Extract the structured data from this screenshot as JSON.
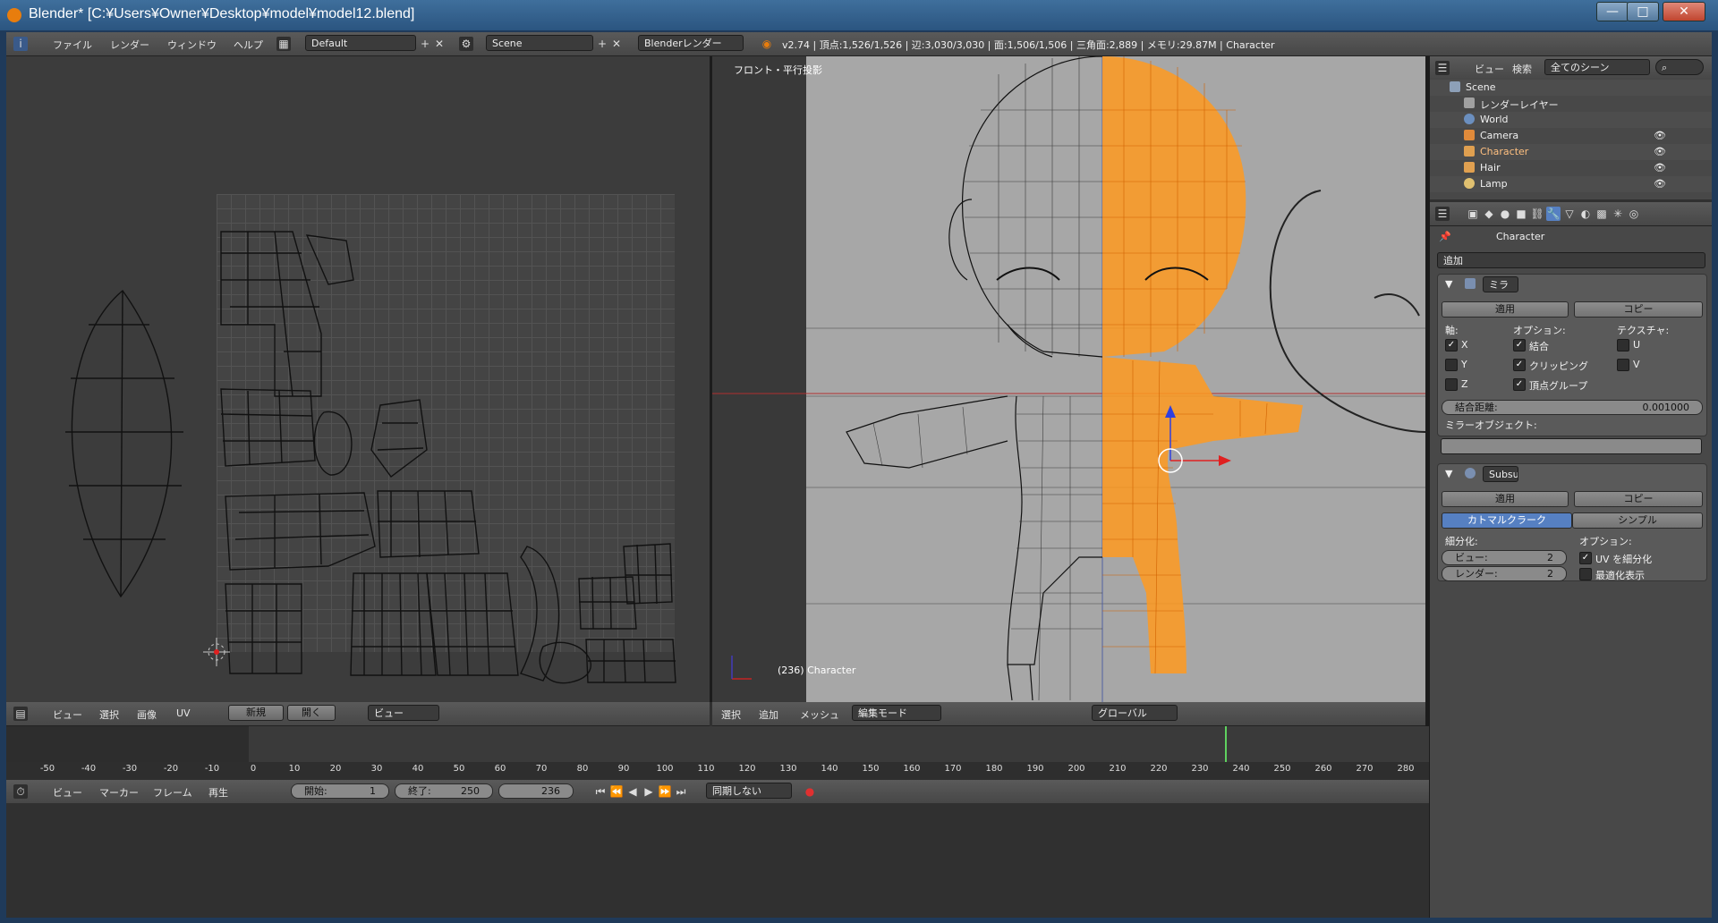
{
  "window": {
    "title": "Blender* [C:¥Users¥Owner¥Desktop¥model¥model12.blend]",
    "minimize": "—",
    "maximize": "□",
    "close": "✕"
  },
  "info_header": {
    "menus": [
      "ファイル",
      "レンダー",
      "ウィンドウ",
      "ヘルプ"
    ],
    "screen_layout": "Default",
    "scene": "Scene",
    "render_engine": "Blenderレンダー",
    "stats": "v2.74 | 頂点:1,526/1,526 | 辺:3,030/3,030 | 面:1,506/1,506 | 三角面:2,889 | メモリ:29.87M | Character"
  },
  "uv_editor": {
    "menus": [
      "ビュー",
      "選択",
      "画像",
      "UV"
    ],
    "new_label": "新規",
    "open_label": "開く",
    "view_label": "ビュー"
  },
  "view3d": {
    "projection_label": "フロント・平行投影",
    "object_label": "(236) Character",
    "menus": [
      "選択",
      "追加",
      "メッシュ"
    ],
    "mode": "編集モード",
    "orientation": "グローバル"
  },
  "outliner": {
    "menus": [
      "ビュー",
      "検索"
    ],
    "scene_filter": "全てのシーン",
    "items": [
      {
        "label": "Scene",
        "icon_color": "#8da0b8"
      },
      {
        "label": "レンダーレイヤー",
        "icon_color": "#a0a0a0"
      },
      {
        "label": "World",
        "icon_color": "#6b8fbf"
      },
      {
        "label": "Camera",
        "icon_color": "#e08a3a"
      },
      {
        "label": "Character",
        "icon_color": "#e0a050"
      },
      {
        "label": "Hair",
        "icon_color": "#e0a050"
      },
      {
        "label": "Lamp",
        "icon_color": "#e0c070"
      }
    ]
  },
  "properties": {
    "breadcrumb": "Character",
    "add_modifier": "追加",
    "mirror": {
      "name": "ミラ",
      "apply": "適用",
      "copy": "コピー",
      "axis_heading": "軸:",
      "options_heading": "オプション:",
      "texture_heading": "テクスチャ:",
      "axes": [
        {
          "label": "X",
          "checked": true
        },
        {
          "label": "Y",
          "checked": false
        },
        {
          "label": "Z",
          "checked": false
        }
      ],
      "options": [
        {
          "label": "結合",
          "checked": true
        },
        {
          "label": "クリッピング",
          "checked": true
        },
        {
          "label": "頂点グループ",
          "checked": true
        }
      ],
      "textures": [
        {
          "label": "U",
          "checked": false
        },
        {
          "label": "V",
          "checked": false
        }
      ],
      "merge_distance_label": "結合距離:",
      "merge_distance_value": "0.001000",
      "mirror_object_label": "ミラーオブジェクト:"
    },
    "subsurf": {
      "name": "Subsu",
      "apply": "適用",
      "copy": "コピー",
      "tab_catmull": "カトマルクラーク",
      "tab_simple": "シンプル",
      "subdiv_heading": "細分化:",
      "options_heading": "オプション:",
      "view_label": "ビュー:",
      "view_value": "2",
      "render_label": "レンダー:",
      "render_value": "2",
      "uv_subdiv": "UV を細分化",
      "uv_subdiv_checked": true,
      "optimal": "最適化表示",
      "optimal_checked": false
    }
  },
  "timeline": {
    "ticks": [
      "-50",
      "-40",
      "-30",
      "-20",
      "-10",
      "0",
      "10",
      "20",
      "30",
      "40",
      "50",
      "60",
      "70",
      "80",
      "90",
      "100",
      "110",
      "120",
      "130",
      "140",
      "150",
      "160",
      "170",
      "180",
      "190",
      "200",
      "210",
      "220",
      "230",
      "240",
      "250",
      "260",
      "270",
      "280"
    ],
    "menus": [
      "ビュー",
      "マーカー",
      "フレーム",
      "再生"
    ],
    "start_label": "開始:",
    "start_value": "1",
    "end_label": "終了:",
    "end_value": "250",
    "current_frame": "236",
    "sync": "同期しない"
  },
  "colors": {
    "accent_blue": "#5680c2",
    "selected_orange": "#ff8c00",
    "panel_bg": "#484848"
  }
}
